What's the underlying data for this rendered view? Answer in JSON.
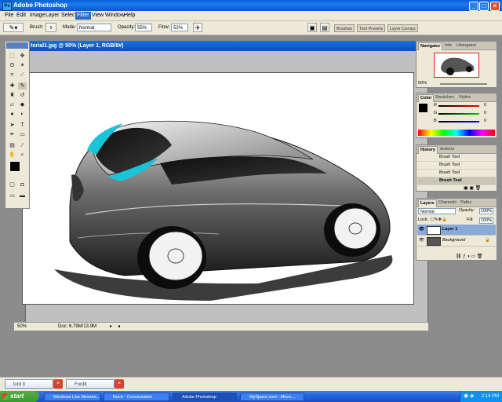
{
  "window": {
    "title": "Adobe Photoshop",
    "app_icon_label": "Ps"
  },
  "menu": [
    "File",
    "Edit",
    "Image",
    "Layer",
    "Select",
    "Filter",
    "View",
    "Window",
    "Help"
  ],
  "menu_selected": "Filter",
  "options": {
    "brush_label": "Brush:",
    "brush_size": "5",
    "mode_label": "Mode:",
    "mode_value": "Normal",
    "opacity_label": "Opacity:",
    "opacity_value": "55%",
    "flow_label": "Flow:",
    "flow_value": "52%"
  },
  "palette_well": [
    "Brushes",
    "Tool Presets",
    "Layer Comps"
  ],
  "document": {
    "title": "torial1.jpg @ 50% (Layer 1, RGB/8#)",
    "zoom": "50%",
    "doc_info": "Doc: 6.79M/13.9M"
  },
  "navigator": {
    "tabs": [
      "Navigator",
      "Info",
      "Histogram"
    ],
    "zoom": "50%"
  },
  "color": {
    "tabs": [
      "Color",
      "Swatches",
      "Styles"
    ],
    "channels": [
      "R",
      "G",
      "B"
    ],
    "values": [
      "0",
      "0",
      "0"
    ]
  },
  "history": {
    "tabs": [
      "History",
      "Actions"
    ],
    "items": [
      "Brush Tool",
      "Brush Tool",
      "Brush Tool",
      "Brush Tool"
    ]
  },
  "layers": {
    "tabs": [
      "Layers",
      "Channels",
      "Paths"
    ],
    "blend_mode": "Normal",
    "opacity_label": "Opacity:",
    "opacity": "100%",
    "lock_label": "Lock:",
    "fill_label": "Fill:",
    "fill": "100%",
    "items": [
      "Layer 1",
      "Background"
    ]
  },
  "messenger_tabs": [
    "lord tt",
    "Fordtt"
  ],
  "taskbar": {
    "start": "start",
    "tasks": [
      "Windows Live Messen...",
      "Roch - Conversation",
      "Adobe Photoshop",
      "MySpace.com - Micro..."
    ],
    "active_task": "Adobe Photoshop",
    "time": "2:14 PM"
  },
  "colors": {
    "titlebar": "#0a5fd8",
    "menu_bg": "#ece9d8",
    "taskbar": "#245edb",
    "start": "#3c9a31",
    "car_accent": "#1ac4d8"
  }
}
